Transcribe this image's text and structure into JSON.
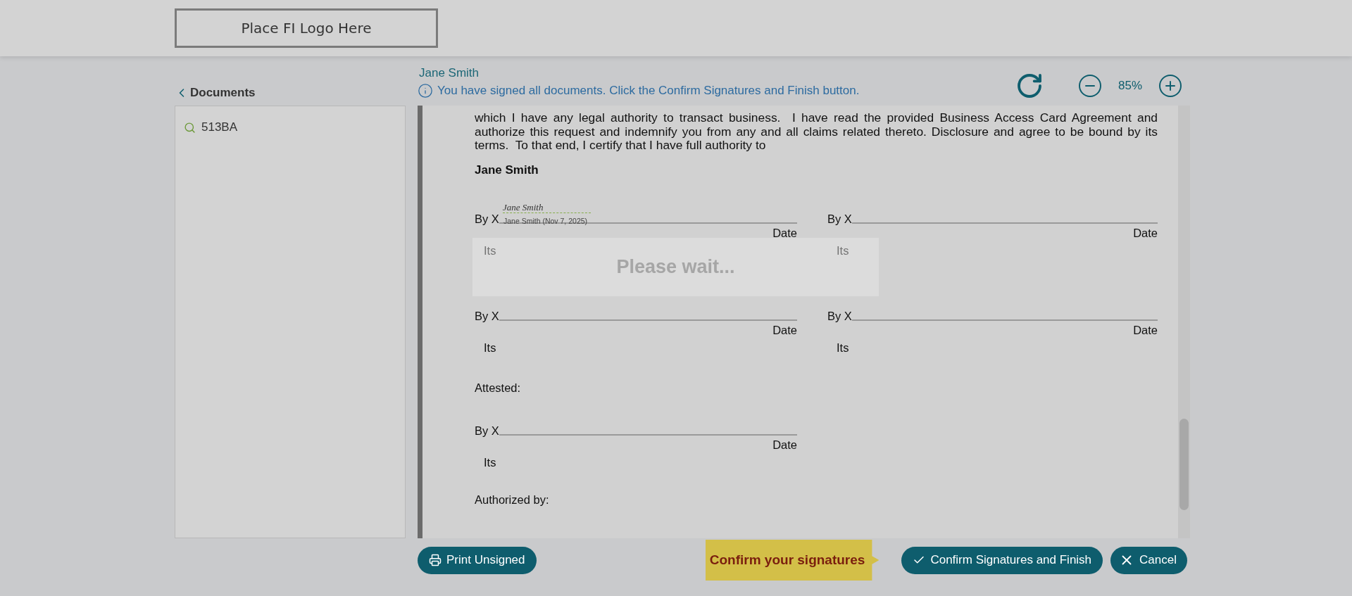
{
  "header": {
    "logo": "Place FI Logo Here"
  },
  "sidebar": {
    "back_label": "Documents",
    "documents": [
      {
        "name": "513BA"
      }
    ]
  },
  "signer": "Jane Smith",
  "notice": "You have signed all documents. Click the Confirm Signatures and Finish button.",
  "zoom": "85%",
  "document": {
    "paragraph": "which I have any legal authority to transact business.  I have read the provided Business Access Card Agreement and authorize this request and indemnify you from any and all claims related thereto. Disclosure and agree to be bound by its terms.  To that end, I certify that I have full authority to",
    "signer_name": "Jane Smith",
    "blocks": [
      {
        "kind": "pair",
        "lines": [
          {
            "by": "By X",
            "date": "Date",
            "its": "Its",
            "signature": {
              "script": "Jane Smith",
              "caption": "Jane Smith (Nov 7, 2025)"
            }
          },
          {
            "by": "By X",
            "date": "Date",
            "its": "Its"
          }
        ]
      },
      {
        "kind": "pair",
        "lines": [
          {
            "by": "By X",
            "date": "Date",
            "its": "Its"
          },
          {
            "by": "By X",
            "date": "Date",
            "its": "Its"
          }
        ]
      },
      {
        "kind": "label",
        "text": "Attested:"
      },
      {
        "kind": "single",
        "lines": [
          {
            "by": "By X",
            "date": "Date",
            "its": "Its"
          }
        ]
      },
      {
        "kind": "label",
        "text": "Authorized by:"
      }
    ]
  },
  "overlay": {
    "message": "Please wait..."
  },
  "footer": {
    "print": "Print Unsigned",
    "hint": "Confirm your signatures",
    "confirm": "Confirm Signatures and Finish",
    "cancel": "Cancel"
  }
}
